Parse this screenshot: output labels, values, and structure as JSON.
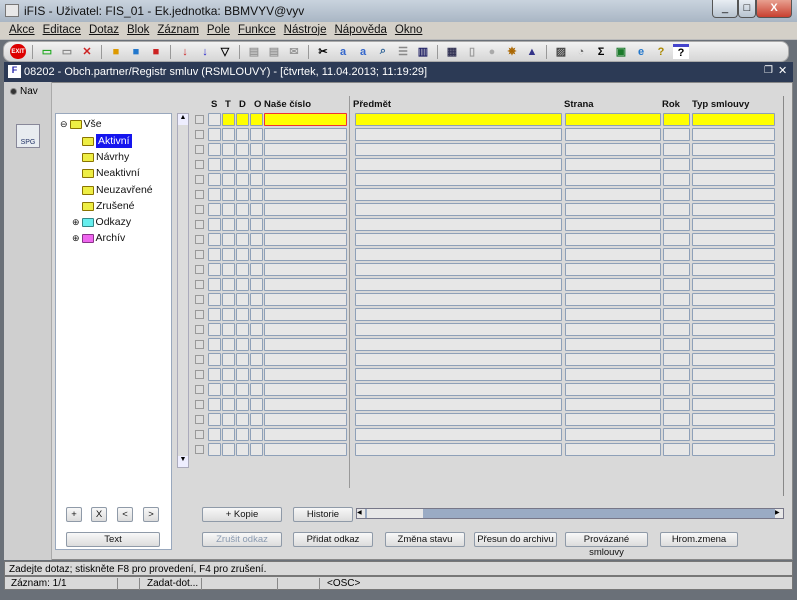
{
  "window": {
    "title": "iFIS - Uživatel: FIS_01 - Ek.jednotka: BBMVYV@vyv",
    "minimize": "_",
    "maximize": "□",
    "close": "X"
  },
  "menu": [
    "Akce",
    "Editace",
    "Dotaz",
    "Blok",
    "Záznam",
    "Pole",
    "Funkce",
    "Nástroje",
    "Nápověda",
    "Okno"
  ],
  "toolbar": {
    "exit_label": "EXIT",
    "icons": [
      "exit-icon",
      "add-record-icon",
      "copy-record-icon",
      "delete-record-icon",
      "query-enter-icon",
      "query-execute-icon",
      "query-cancel-icon",
      "sort-asc-icon",
      "sort-desc-icon",
      "filter-icon",
      "print-icon",
      "print-preview-icon",
      "mail-icon",
      "cut-icon",
      "copy-icon",
      "paste-icon",
      "search-icon",
      "list-icon",
      "columns-icon",
      "form-icon",
      "document-icon",
      "globe-icon",
      "wheel-icon",
      "ruler-icon",
      "chart-icon",
      "clock-icon",
      "sum-icon",
      "excel-icon",
      "ie-icon",
      "help-icon",
      "help-context-icon"
    ]
  },
  "form": {
    "title": "08202 - Obch.partner/Registr smluv (RSMLOUVY) - [čtvrtek, 11.04.2013; 11:19:29]"
  },
  "nav": {
    "radio_label": "Nav",
    "spg_label": "SPG"
  },
  "tree": {
    "root": "Vše",
    "items": [
      "Aktivní",
      "Návrhy",
      "Neaktivní",
      "Neuzavřené",
      "Zrušené",
      "Odkazy",
      "Archív"
    ]
  },
  "tree_buttons": {
    "add": "+",
    "remove": "X",
    "prev": "<",
    "next": ">",
    "text": "Text"
  },
  "grid": {
    "columns": [
      "S",
      "T",
      "D",
      "O",
      "Naše číslo",
      "Předmět",
      "Strana",
      "Rok",
      "Typ smlouvy"
    ],
    "row_count": 23
  },
  "buttons": {
    "kopie": "+ Kopie",
    "historie": "Historie",
    "zrusit_odkaz": "Zrušit odkaz",
    "pridat_odkaz": "Přidat odkaz",
    "zmena_stavu": "Změna stavu",
    "presun": "Přesun do archivu",
    "provazane": "Provázané smlouvy",
    "hrom": "Hrom.zmena"
  },
  "status": {
    "message": "Zadejte dotaz; stiskněte F8 pro provedení, F4 pro zrušení.",
    "record": "Záznam: 1/1",
    "mode": "Zadat-dot...",
    "osc": "<OSC>"
  }
}
